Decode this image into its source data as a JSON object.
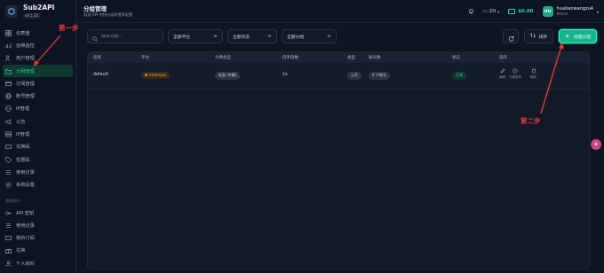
{
  "brand": {
    "name": "Sub2API",
    "version": "v0.1.35"
  },
  "sidebar": {
    "items": [
      {
        "label": "仪表盘",
        "icon": "dashboard-icon"
      },
      {
        "label": "运维监控",
        "icon": "chart-icon"
      },
      {
        "label": "用户管理",
        "icon": "users-icon"
      },
      {
        "label": "分组管理",
        "icon": "folder-icon",
        "active": true
      },
      {
        "label": "订阅管理",
        "icon": "card-icon"
      },
      {
        "label": "账号管理",
        "icon": "globe-icon"
      },
      {
        "label": "IP管理",
        "icon": "globe-icon"
      },
      {
        "label": "公告",
        "icon": "megaphone-icon"
      },
      {
        "label": "IP管理",
        "icon": "server-icon"
      },
      {
        "label": "兑换码",
        "icon": "ticket-icon"
      },
      {
        "label": "优惠码",
        "icon": "tag-icon"
      },
      {
        "label": "使用记录",
        "icon": "list-icon"
      },
      {
        "label": "系统设置",
        "icon": "gear-icon"
      }
    ],
    "section_label": "我的账户",
    "account_items": [
      {
        "label": "API 密钥",
        "icon": "key-icon"
      },
      {
        "label": "使用记录",
        "icon": "list-icon"
      },
      {
        "label": "我的订阅",
        "icon": "card-icon"
      },
      {
        "label": "兑换",
        "icon": "gift-icon"
      },
      {
        "label": "个人资料",
        "icon": "user-icon"
      }
    ]
  },
  "header": {
    "title": "分组管理",
    "subtitle": "管理 API 密钥分组和费率配置",
    "lang": "ZH",
    "balance": "$0.00",
    "user": {
      "initials": "HU",
      "name": "huatianwangzu4",
      "role": "Admin"
    }
  },
  "filters": {
    "search_placeholder": "搜索分组...",
    "platform": "全部平台",
    "status": "全部状态",
    "group_type": "全部分组"
  },
  "actions": {
    "sort_label": "排序",
    "create_label": "创建分组"
  },
  "table": {
    "columns": [
      "名称",
      "平台",
      "计费类型",
      "倍率倍数",
      "类型",
      "账号数",
      "状态",
      "操作"
    ],
    "rows": [
      {
        "name": "default",
        "platform": "Anthropic",
        "billing": "标准 (余额)",
        "rate": "1x",
        "type": "公开",
        "accounts": "0 个账号",
        "status": "正常",
        "ops": [
          "编辑",
          "专属倍率",
          "删除"
        ]
      }
    ]
  },
  "annotations": {
    "step1": "第一步",
    "step2": "第二步"
  },
  "colors": {
    "accent": "#16b58d",
    "annotation": "#ea3b3b"
  }
}
